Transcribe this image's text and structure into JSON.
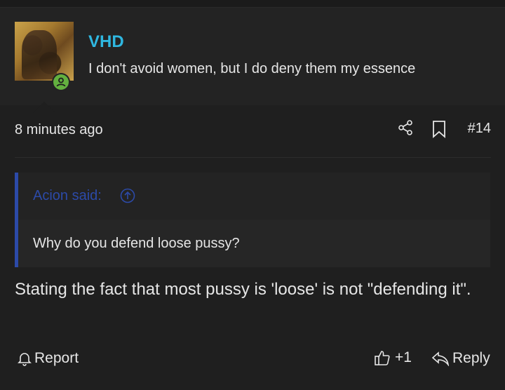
{
  "user": {
    "name": "VHD",
    "title": "I don't avoid women, but I do deny them my essence",
    "status": "online"
  },
  "post": {
    "timestamp": "8 minutes ago",
    "number": "#14",
    "quote": {
      "author": "Acion said:",
      "text": "Why do you defend loose pussy?"
    },
    "message": "Stating the fact that most pussy is 'loose' is not \"defending it\"."
  },
  "actions": {
    "report_label": "Report",
    "like_count": "+1",
    "reply_label": "Reply"
  },
  "colors": {
    "username": "#2fb7e0",
    "quote_accent": "#2c4aa8",
    "online": "#63b13f",
    "text": "#e6e6e6",
    "background": "#1f1f1f"
  },
  "icons": {
    "share": "share-icon",
    "bookmark": "bookmark-icon",
    "quote_jump": "arrow-up-circle-icon",
    "report": "bell-icon",
    "like": "thumbs-up-icon",
    "reply": "reply-icon",
    "online": "user-icon"
  }
}
